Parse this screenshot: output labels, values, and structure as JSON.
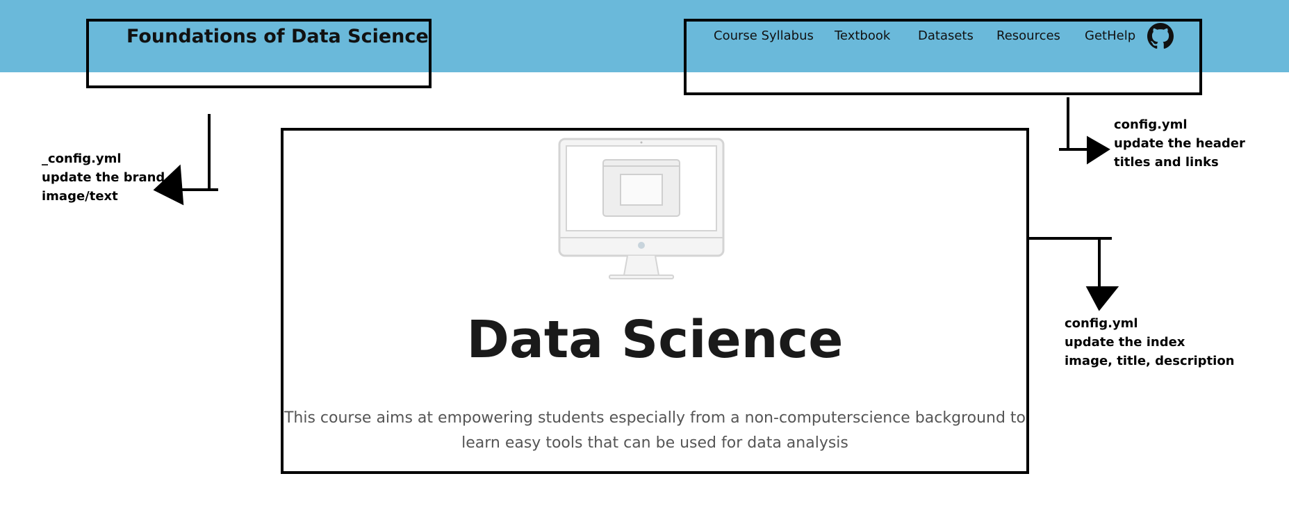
{
  "header": {
    "brand": "Foundations of Data Science",
    "nav": [
      {
        "label": "Course Syllabus"
      },
      {
        "label": "Textbook"
      },
      {
        "label": "Datasets"
      },
      {
        "label": "Resources"
      },
      {
        "label": "GetHelp"
      }
    ],
    "github_icon": "github-icon",
    "background_color": "#6ab9da"
  },
  "hero": {
    "image_icon": "desktop-monitor-icon",
    "title": "Data Science",
    "description": "This course aims at empowering students especially from a non-computerscience background to\nlearn easy tools that can be used for data analysis"
  },
  "annotations": {
    "brand_note": "_config.yml\nupdate the brand.\nimage/text",
    "header_note": "config.yml\nupdate the header\ntitles and links",
    "index_note": "config.yml\nupdate the index\nimage, title, description"
  }
}
